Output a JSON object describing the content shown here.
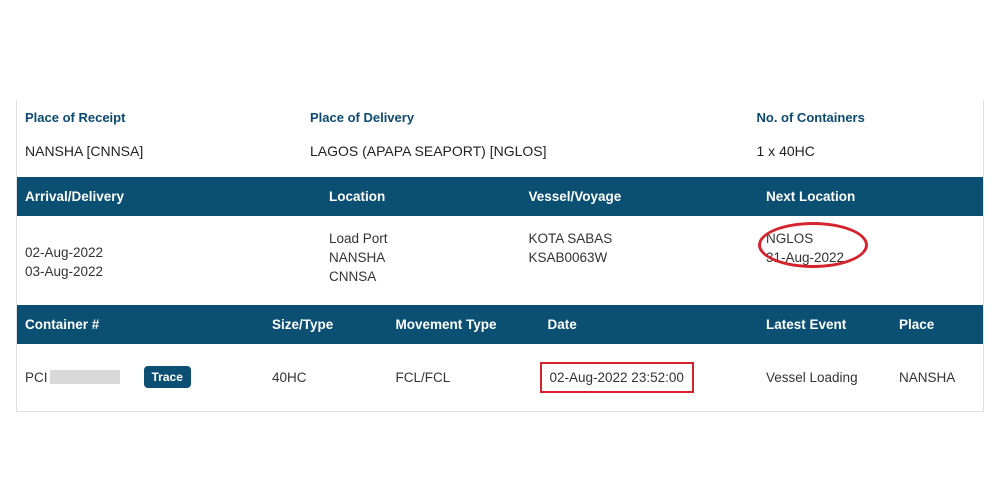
{
  "summary": {
    "receipt_label": "Place of Receipt",
    "receipt_value": "NANSHA [CNNSA]",
    "delivery_label": "Place of Delivery",
    "delivery_value": "LAGOS (APAPA SEAPORT) [NGLOS]",
    "containers_label": "No. of Containers",
    "containers_value": "1 x 40HC"
  },
  "voyage": {
    "header": {
      "arrival": "Arrival/Delivery",
      "location": "Location",
      "vessel": "Vessel/Voyage",
      "next": "Next Location"
    },
    "row": {
      "date1": "02-Aug-2022",
      "date2": "03-Aug-2022",
      "loc_type": "Load Port",
      "loc_name": "NANSHA",
      "loc_code": "CNNSA",
      "vessel_name": "KOTA SABAS",
      "voyage_code": "KSAB0063W",
      "next_loc": "NGLOS",
      "next_date": "31-Aug-2022"
    }
  },
  "containers": {
    "header": {
      "num": "Container #",
      "size": "Size/Type",
      "movement": "Movement Type",
      "date": "Date",
      "event": "Latest Event",
      "place": "Place"
    },
    "row": {
      "prefix": "PCI",
      "trace_label": "Trace",
      "size": "40HC",
      "movement": "FCL/FCL",
      "date": "02-Aug-2022 23:52:00",
      "event": "Vessel Loading",
      "place": "NANSHA"
    }
  }
}
